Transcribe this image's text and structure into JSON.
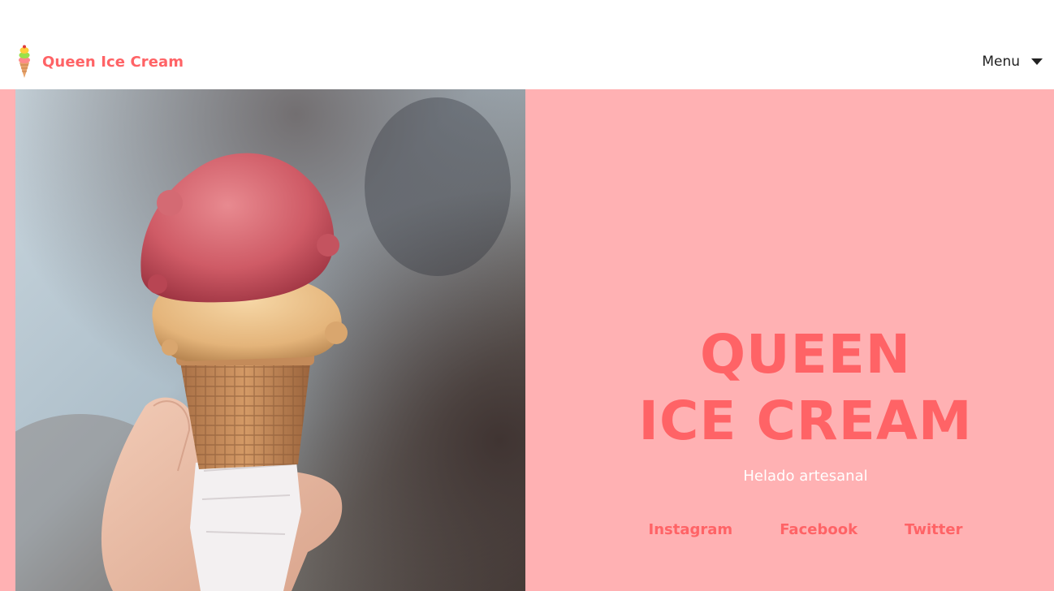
{
  "header": {
    "brand_name": "Queen Ice Cream",
    "menu_label": "Menu"
  },
  "hero": {
    "title_line1": "QUEEN",
    "title_line2": "ICE CREAM",
    "subtitle": "Helado artesanal",
    "social_links": [
      "Instagram",
      "Facebook",
      "Twitter"
    ]
  },
  "colors": {
    "accent": "#ff6366",
    "hero_background": "#ffb1b3",
    "header_background": "#ffffff",
    "menu_text": "#222222",
    "subtitle_text": "#ffffff"
  },
  "icons": {
    "brand_logo": "ice-cream-cone-icon",
    "menu_caret": "caret-down-icon"
  }
}
